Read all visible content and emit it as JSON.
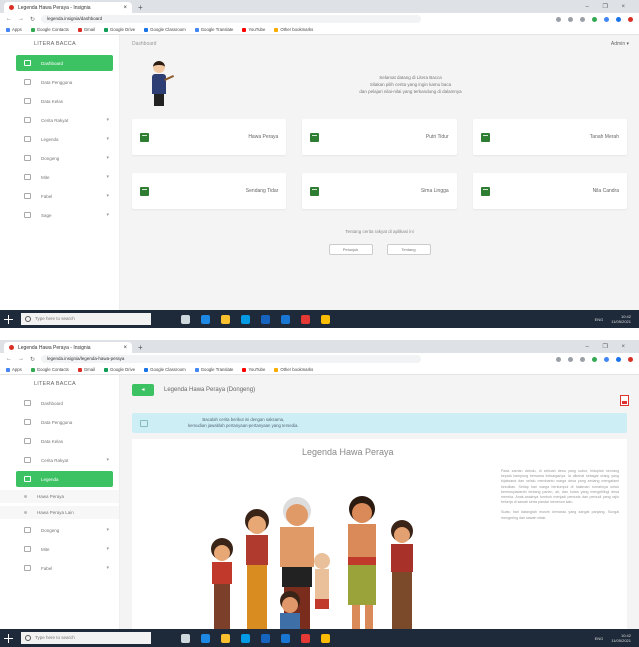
{
  "browser": {
    "tab_title": "Legenda Hawa Peraya - Insignia",
    "tab_close": "×",
    "new_tab": "+",
    "window_controls": "– ❐ ×",
    "url_1": "legenda.insignia/dashboard",
    "url_2": "legenda.insignia/legenda-hawa-peraya"
  },
  "bookmarks": [
    {
      "label": "Apps",
      "color": "#4285f4"
    },
    {
      "label": "Google Contacts",
      "color": "#34a853"
    },
    {
      "label": "Gmail",
      "color": "#d93025"
    },
    {
      "label": "Google Drive",
      "color": "#0f9d58"
    },
    {
      "label": "Google Classroom",
      "color": "#1a73e8"
    },
    {
      "label": "Google Translate",
      "color": "#4285f4"
    },
    {
      "label": "YouTube",
      "color": "#ff0000"
    },
    {
      "label": "Other bookmarks",
      "color": "#f9ab00"
    }
  ],
  "sidebar": {
    "brand": "LITERA BACCA",
    "items_1": [
      {
        "label": "Dashboard",
        "active": true
      },
      {
        "label": "Data Pengguna"
      },
      {
        "label": "Data Kelas"
      },
      {
        "label": "Cerita Rakyat",
        "chevron": true
      },
      {
        "label": "Legenda",
        "chevron": true
      },
      {
        "label": "Dongeng",
        "chevron": true
      },
      {
        "label": "Mite",
        "chevron": true
      },
      {
        "label": "Fabel",
        "chevron": true
      },
      {
        "label": "Sage",
        "chevron": true
      }
    ],
    "items_2": [
      {
        "label": "Dashboard"
      },
      {
        "label": "Data Pengguna"
      },
      {
        "label": "Data Kelas"
      },
      {
        "label": "Cerita Rakyat",
        "chevron": true
      },
      {
        "label": "Legenda",
        "active": true
      },
      {
        "label": "Hawa Peraya",
        "sub": true
      },
      {
        "label": "Hawa Peraya Lain",
        "sub": true
      },
      {
        "label": "Dongeng",
        "chevron": true
      },
      {
        "label": "Mite",
        "chevron": true
      },
      {
        "label": "Fabel",
        "chevron": true
      }
    ]
  },
  "dashboard": {
    "header": "Dashboard",
    "user": "Admin ▾",
    "welcome_lines": [
      "Selamat datang di Litera Bacca",
      "Silakan pilih cerita yang ingin kamu baca",
      "dan pelajari nilai-nilai yang terkandung di dalamnya"
    ],
    "cards": [
      "Hawa Peraya",
      "Putri Tidur",
      "Tanah Merah",
      "Sendang Tidar",
      "Sima Lingga",
      "Nila Candra"
    ],
    "footer_text": "Tentang cerita rakyat di aplikasi ini",
    "footer_buttons": [
      "Petunjuk",
      "Tentang"
    ]
  },
  "reading": {
    "back_label": "◂",
    "title": "Legenda Hawa Peraya (Dongeng)",
    "info_lines": [
      "Bacalah cerita berikut ini dengan saksama,",
      "kemudian jawablah pertanyaan-pertanyaan yang tersedia."
    ],
    "story_title": "Legenda Hawa Peraya",
    "paragraphs": [
      "Pada zaman dahulu, di sebuah desa yang subur, hiduplah seorang kepala kampung bersama keluarganya. Ia dikenal sebagai orang yang bijaksana dan selalu membantu warga desa yang sedang mengalami kesulitan. Setiap hari warga berkumpul di halaman rumahnya untuk bermusyawarah tentang panen, air, dan hutan yang mengelilingi desa mereka. Anak-anaknya tumbuh menjadi pemuda dan pemudi yang rajin bekerja di sawah serta pandai menenun kain.",
      "Suatu hari datanglah musim kemarau yang sangat panjang. Sungai mengering dan sawah retak."
    ]
  },
  "taskbar": {
    "search_placeholder": "Type here to search",
    "tray_time": "10:42",
    "tray_date": "11/05/2021",
    "tray_lang": "ENG",
    "icons": [
      {
        "name": "task-view",
        "color": "#cfd8dc"
      },
      {
        "name": "edge",
        "color": "#1e88e5"
      },
      {
        "name": "explorer",
        "color": "#fbc02d"
      },
      {
        "name": "store",
        "color": "#039be5"
      },
      {
        "name": "mail",
        "color": "#1565c0"
      },
      {
        "name": "word",
        "color": "#1976d2"
      },
      {
        "name": "acrobat",
        "color": "#e53935"
      },
      {
        "name": "chrome",
        "color": "#fbbc04"
      }
    ]
  }
}
